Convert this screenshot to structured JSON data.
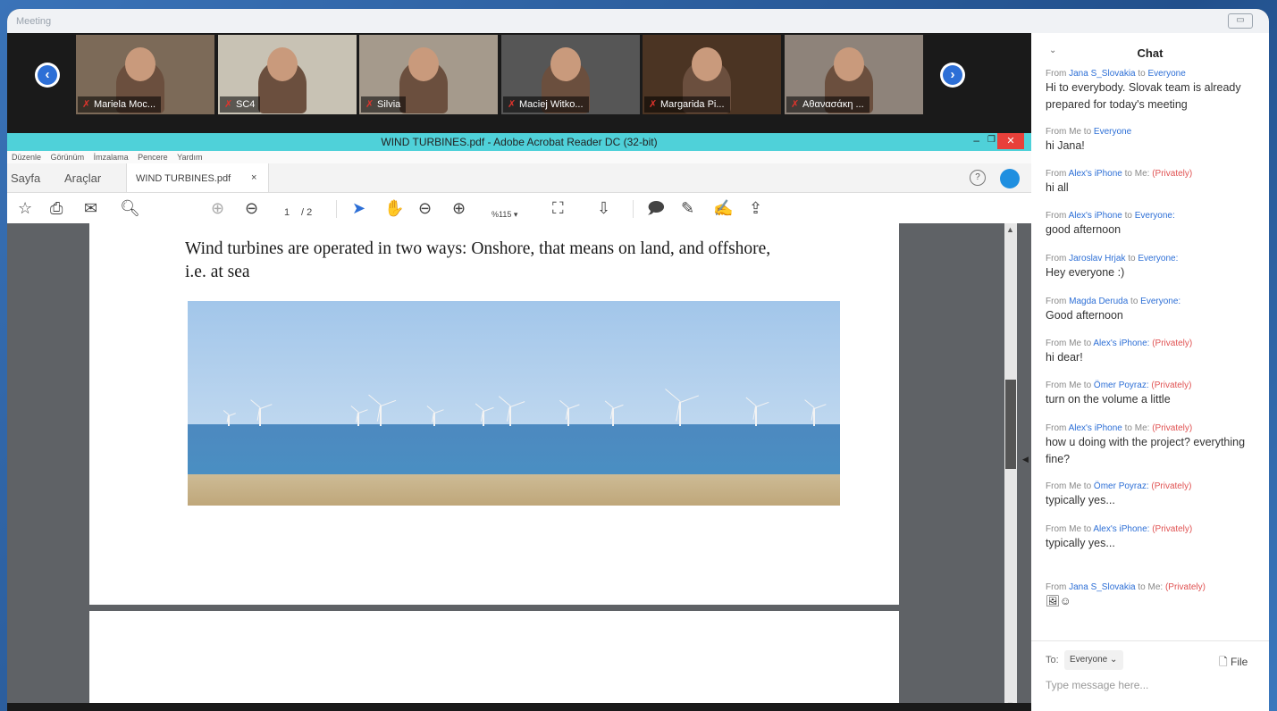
{
  "window": {
    "title": "Meeting",
    "restore_label": "▭"
  },
  "videos": {
    "prev_label": "‹",
    "next_label": "›",
    "participants": [
      {
        "name": "Mariela Moc...",
        "bg": "#7c6a58"
      },
      {
        "name": "SC4",
        "bg": "#c8c2b4"
      },
      {
        "name": "Silvia",
        "bg": "#a59a8c"
      },
      {
        "name": "Maciej Witko...",
        "bg": "#565656"
      },
      {
        "name": "Margarida Pi...",
        "bg": "#4b3423"
      },
      {
        "name": "Αθανασάκη ...",
        "bg": "#8e837a"
      }
    ]
  },
  "acrobat": {
    "title": "WIND TURBINES.pdf - Adobe Acrobat Reader DC (32-bit)",
    "menu": [
      "Düzenle",
      "Görünüm",
      "İmzalama",
      "Pencere",
      "Yardım"
    ],
    "tabs": {
      "home": "Sayfa",
      "tools": "Araçlar",
      "doc": "WIND TURBINES.pdf",
      "close": "×"
    },
    "toolbar": {
      "page_current": "1",
      "page_total": "/ 2",
      "zoom": "%115 ▾"
    },
    "page_text": "Wind turbines are operated in two ways: Onshore, that means on land, and offshore, i.e. at sea"
  },
  "chat": {
    "title": "Chat",
    "messages": [
      {
        "prefix": "From ",
        "from": "Jana S_Slovakia",
        "mid": " to ",
        "to": "Everyone",
        "priv": "",
        "body": "Hi to everybody. Slovak team is already prepared for today's meeting"
      },
      {
        "prefix": "From ",
        "from": "Me",
        "mid": " to ",
        "to": "Everyone",
        "priv": "",
        "body": "hi Jana!"
      },
      {
        "prefix": "From ",
        "from": "Alex's iPhone",
        "mid": " to ",
        "to": "Me:",
        "priv": "(Privately)",
        "body": "hi all"
      },
      {
        "prefix": "From ",
        "from": "Alex's iPhone",
        "mid": " to ",
        "to": "Everyone:",
        "priv": "",
        "body": "good afternoon"
      },
      {
        "prefix": "From ",
        "from": "Jaroslav Hrjak",
        "mid": " to ",
        "to": "Everyone:",
        "priv": "",
        "body": "Hey everyone :)"
      },
      {
        "prefix": "From ",
        "from": "Magda Deruda",
        "mid": " to ",
        "to": "Everyone:",
        "priv": "",
        "body": "Good afternoon"
      },
      {
        "prefix": "From ",
        "from": "Me",
        "mid": " to ",
        "to": "Alex's iPhone:",
        "priv": "(Privately)",
        "body": "hi dear!"
      },
      {
        "prefix": "From ",
        "from": "Me",
        "mid": " to ",
        "to": "Ömer Poyraz:",
        "priv": "(Privately)",
        "body": "turn on the volume a little"
      },
      {
        "prefix": "From ",
        "from": "Alex's iPhone",
        "mid": " to ",
        "to": "Me:",
        "priv": "(Privately)",
        "body": "how u doing with the project? everything fine?"
      },
      {
        "prefix": "From ",
        "from": "Me",
        "mid": " to ",
        "to": "Ömer Poyraz:",
        "priv": "(Privately)",
        "body": "typically yes..."
      },
      {
        "prefix": "From ",
        "from": "Me",
        "mid": " to ",
        "to": "Alex's iPhone:",
        "priv": "(Privately)",
        "body": "typically yes..."
      },
      {
        "prefix": "From ",
        "from": "Jana S_Slovakia",
        "mid": " to ",
        "to": "Me:",
        "priv": "(Privately)",
        "body": "🖼☺"
      }
    ],
    "composer": {
      "to_label": "To:",
      "recipient": "Everyone ⌄",
      "file_label": "File",
      "placeholder": "Type message here..."
    }
  },
  "colors": {
    "accent": "#2d6fd6",
    "private": "#e05252",
    "acrobat_title": "#4fd1d9",
    "close": "#e8403a"
  }
}
